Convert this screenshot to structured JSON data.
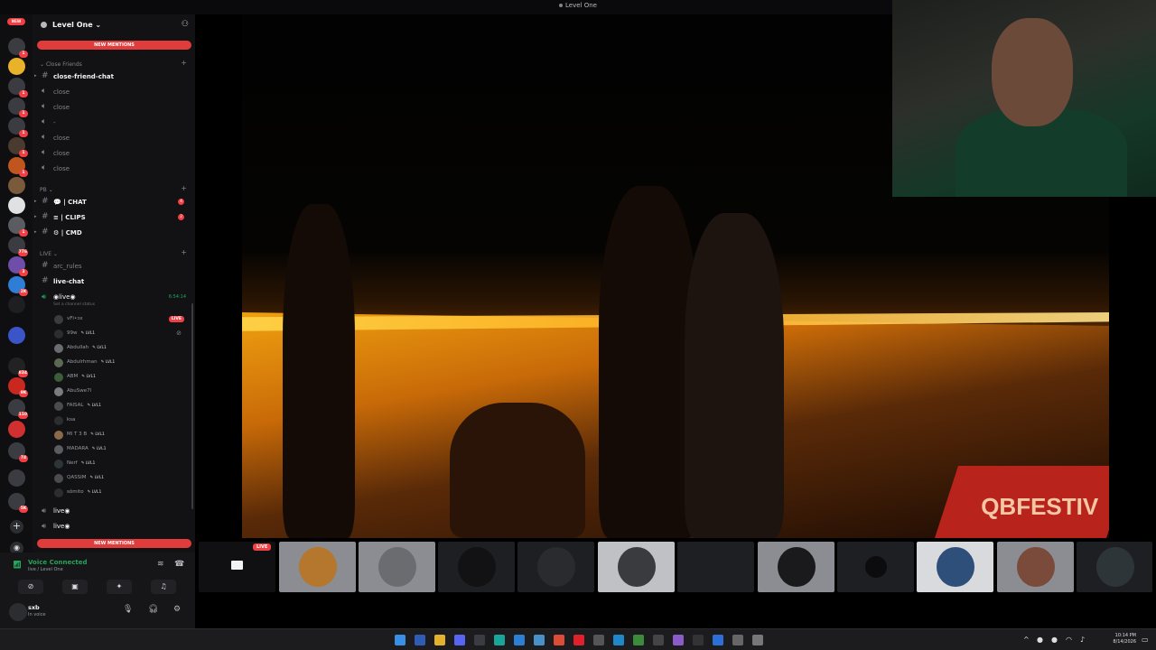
{
  "window": {
    "title": "Level One"
  },
  "rail": {
    "new_label": "NEW",
    "servers": [
      {
        "badge": "1",
        "color": "#3a3c42"
      },
      {
        "badge": "",
        "color": "#e8b22a"
      },
      {
        "badge": "1",
        "color": "#3a3c42"
      },
      {
        "badge": "1",
        "color": "#3a3c42"
      },
      {
        "badge": "1",
        "color": "#3a3c42"
      },
      {
        "badge": "1",
        "color": "#4a3b30"
      },
      {
        "badge": "1",
        "color": "#c0561e"
      },
      {
        "badge": "",
        "color": "#7a5a3a"
      },
      {
        "badge": "",
        "color": "#dfe1e5"
      },
      {
        "badge": "1",
        "color": "#5a5c62"
      },
      {
        "badge": "776",
        "color": "#3a3c42"
      },
      {
        "badge": "3",
        "color": "#6e4ea8"
      },
      {
        "badge": "2K",
        "color": "#2e7dd7"
      },
      {
        "badge": "",
        "color": "#1e1f22"
      },
      {
        "badge": "",
        "color": "#3b55c9"
      },
      {
        "badge": "834",
        "color": "#222"
      },
      {
        "badge": "9K",
        "color": "#c8281e"
      },
      {
        "badge": "110",
        "color": "#3a3c42"
      },
      {
        "badge": "",
        "color": "#d03030"
      },
      {
        "badge": "74",
        "color": "#3a3c42"
      },
      {
        "badge": "",
        "color": "#3a3c42"
      },
      {
        "badge": "5K",
        "color": "#3a3c42"
      }
    ]
  },
  "sidebar": {
    "guild_name": "Level One",
    "new_mentions": "NEW MENTIONS",
    "categories": {
      "close_friends": "Close Friends",
      "pb": "PB",
      "live": "LIVE"
    },
    "channels_close": [
      {
        "name": "close-friend-chat",
        "bright": true
      },
      {
        "name": "close",
        "bright": false
      },
      {
        "name": "close",
        "bright": false
      },
      {
        "name": "-",
        "bright": false
      },
      {
        "name": "close",
        "bright": false
      },
      {
        "name": "close",
        "bright": false
      },
      {
        "name": "close",
        "bright": false
      }
    ],
    "channels_pb": [
      {
        "name": "| CHAT",
        "badge": "4"
      },
      {
        "name": "| CLIPS",
        "badge": "2"
      },
      {
        "name": "| CMD",
        "badge": ""
      }
    ],
    "channels_live": [
      {
        "name": "arc_rules",
        "bright": false
      },
      {
        "name": "live-chat",
        "bright": true
      }
    ],
    "voice_channel": {
      "name": "live",
      "time": "6:54:14",
      "status": "Set a channel status"
    },
    "members": [
      {
        "name": "vFl•ↄx",
        "tag": "",
        "live": "LIVE"
      },
      {
        "name": "99w",
        "tag": "LVL1",
        "deaf": true
      },
      {
        "name": "Abdullah",
        "tag": "LVL1"
      },
      {
        "name": "Abdulrhman",
        "tag": "LVL1"
      },
      {
        "name": "ABM",
        "tag": "LVL1"
      },
      {
        "name": "AbuSwe7l",
        "tag": ""
      },
      {
        "name": "FAISAL",
        "tag": "LVL1"
      },
      {
        "name": "ksa",
        "tag": ""
      },
      {
        "name": "Ml T 3 B",
        "tag": "LVL1"
      },
      {
        "name": "MADARA",
        "tag": "LVL1"
      },
      {
        "name": "Nerf",
        "tag": "LVL1"
      },
      {
        "name": "QASSIM",
        "tag": "LVL1"
      },
      {
        "name": "sômito",
        "tag": "LVL1"
      }
    ],
    "voice_extra": [
      {
        "name": "live"
      },
      {
        "name": "live"
      }
    ]
  },
  "panel": {
    "voice_connected": "Voice Connected",
    "voice_location": "live / Level One",
    "user_name": "sxb",
    "user_status": "In voice"
  },
  "stream": {
    "banner_text": "QBFESTIV"
  },
  "strip": {
    "live_label": "LIVE"
  },
  "taskbar": {
    "time": "10:14 PM",
    "date": "8/14/2026"
  },
  "colors": {
    "accent_red": "#e03c3c",
    "voice_green": "#23a55a"
  }
}
